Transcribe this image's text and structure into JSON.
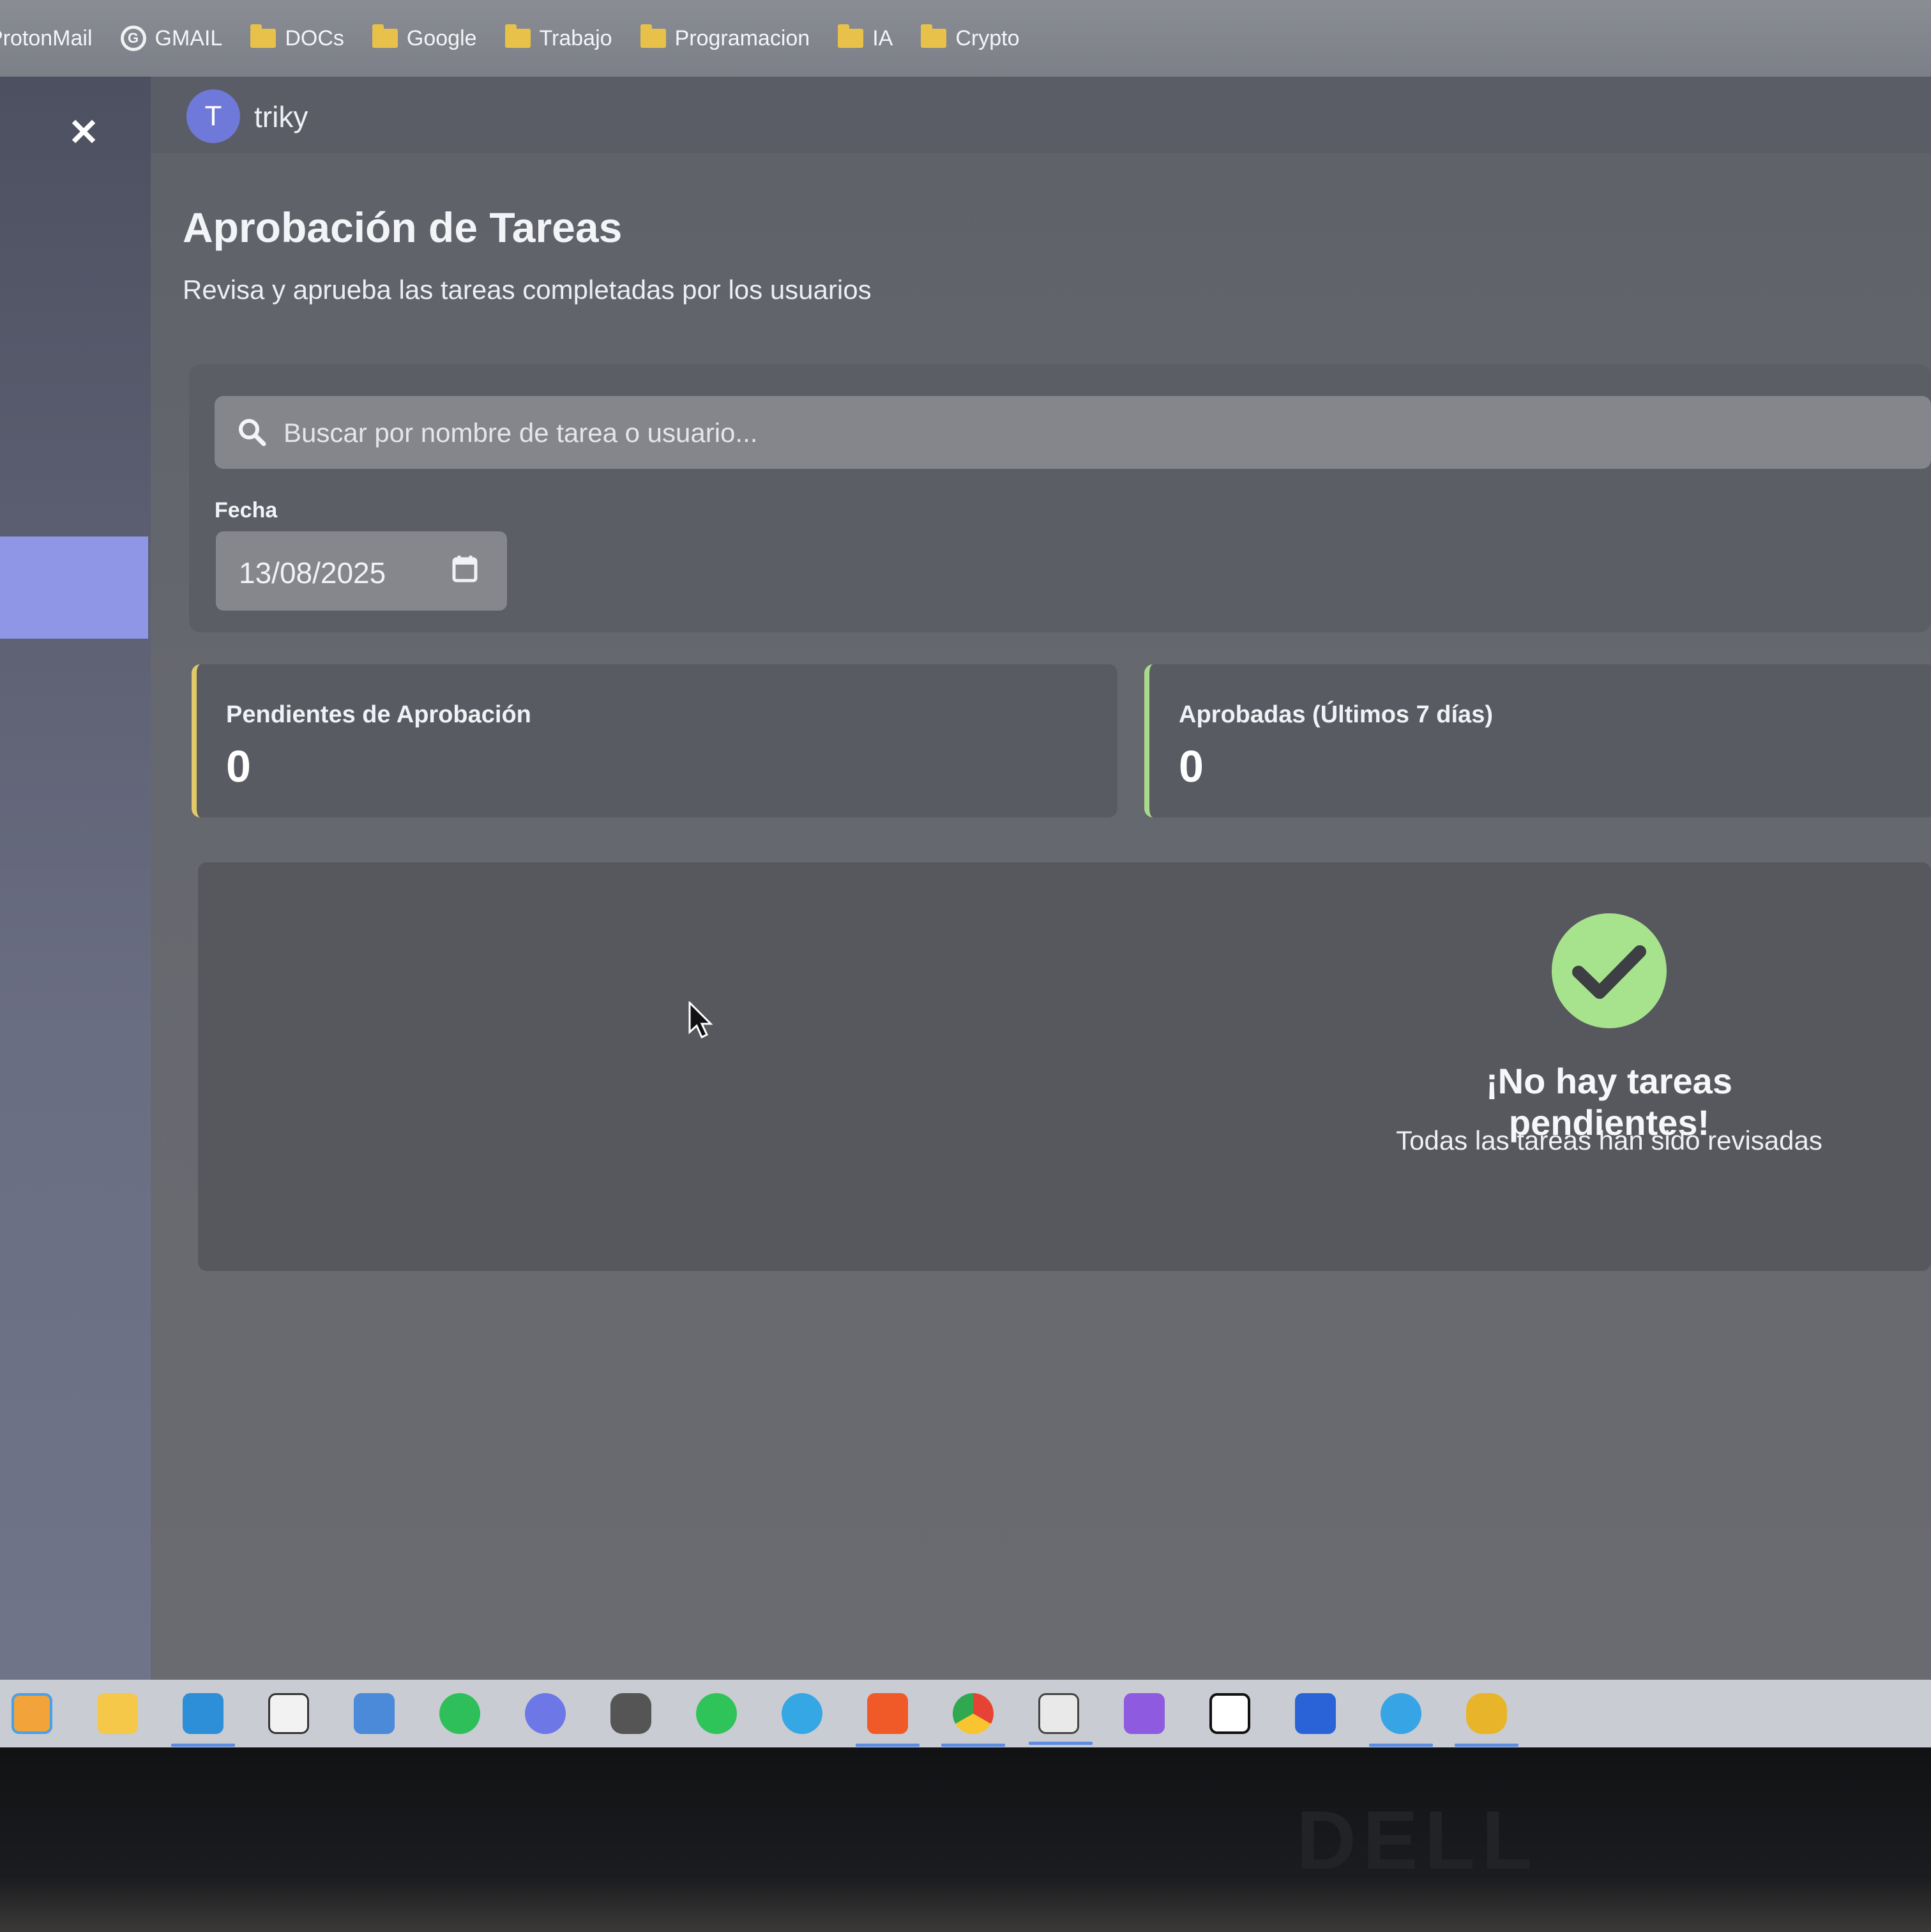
{
  "bookmarks": [
    {
      "label": "ProtonMail",
      "icon": "none"
    },
    {
      "label": "GMAIL",
      "icon": "google-icon"
    },
    {
      "label": "DOCs",
      "icon": "folder-icon"
    },
    {
      "label": "Google",
      "icon": "folder-icon"
    },
    {
      "label": "Trabajo",
      "icon": "folder-icon"
    },
    {
      "label": "Programacion",
      "icon": "folder-icon"
    },
    {
      "label": "IA",
      "icon": "folder-icon"
    },
    {
      "label": "Crypto",
      "icon": "folder-icon"
    }
  ],
  "header": {
    "avatar_letter": "T",
    "username": "triky"
  },
  "page": {
    "title": "Aprobación de Tareas",
    "subtitle": "Revisa y aprueba las tareas completadas por los usuarios"
  },
  "filters": {
    "search_placeholder": "Buscar por nombre de tarea o usuario...",
    "date_label": "Fecha",
    "date_value": "13/08/2025"
  },
  "stats": {
    "pending_label": "Pendientes de Aprobación",
    "pending_value": "0",
    "approved_label": "Aprobadas (Últimos 7 días)",
    "approved_value": "0"
  },
  "empty_state": {
    "title": "¡No hay tareas pendientes!",
    "subtitle": "Todas las tareas han sido revisadas"
  },
  "taskbar": {
    "apps": [
      "multitasking-icon",
      "file-explorer-icon",
      "vscode-icon",
      "notepad-icon",
      "remote-desktop-icon",
      "spotify-icon",
      "discord-icon",
      "game-icon",
      "whatsapp-icon",
      "telegram-icon",
      "brave-icon",
      "chrome-icon",
      "image-editor-icon",
      "mail-icon",
      "notion-icon",
      "bitwarden-icon",
      "docker-icon",
      "dbeaver-icon"
    ]
  },
  "colors": {
    "accent": "#8f96e6",
    "pending_border": "#e2c96a",
    "approved_border": "#a9d98a",
    "check": "#a7e38d"
  },
  "monitor_brand": "DELL"
}
